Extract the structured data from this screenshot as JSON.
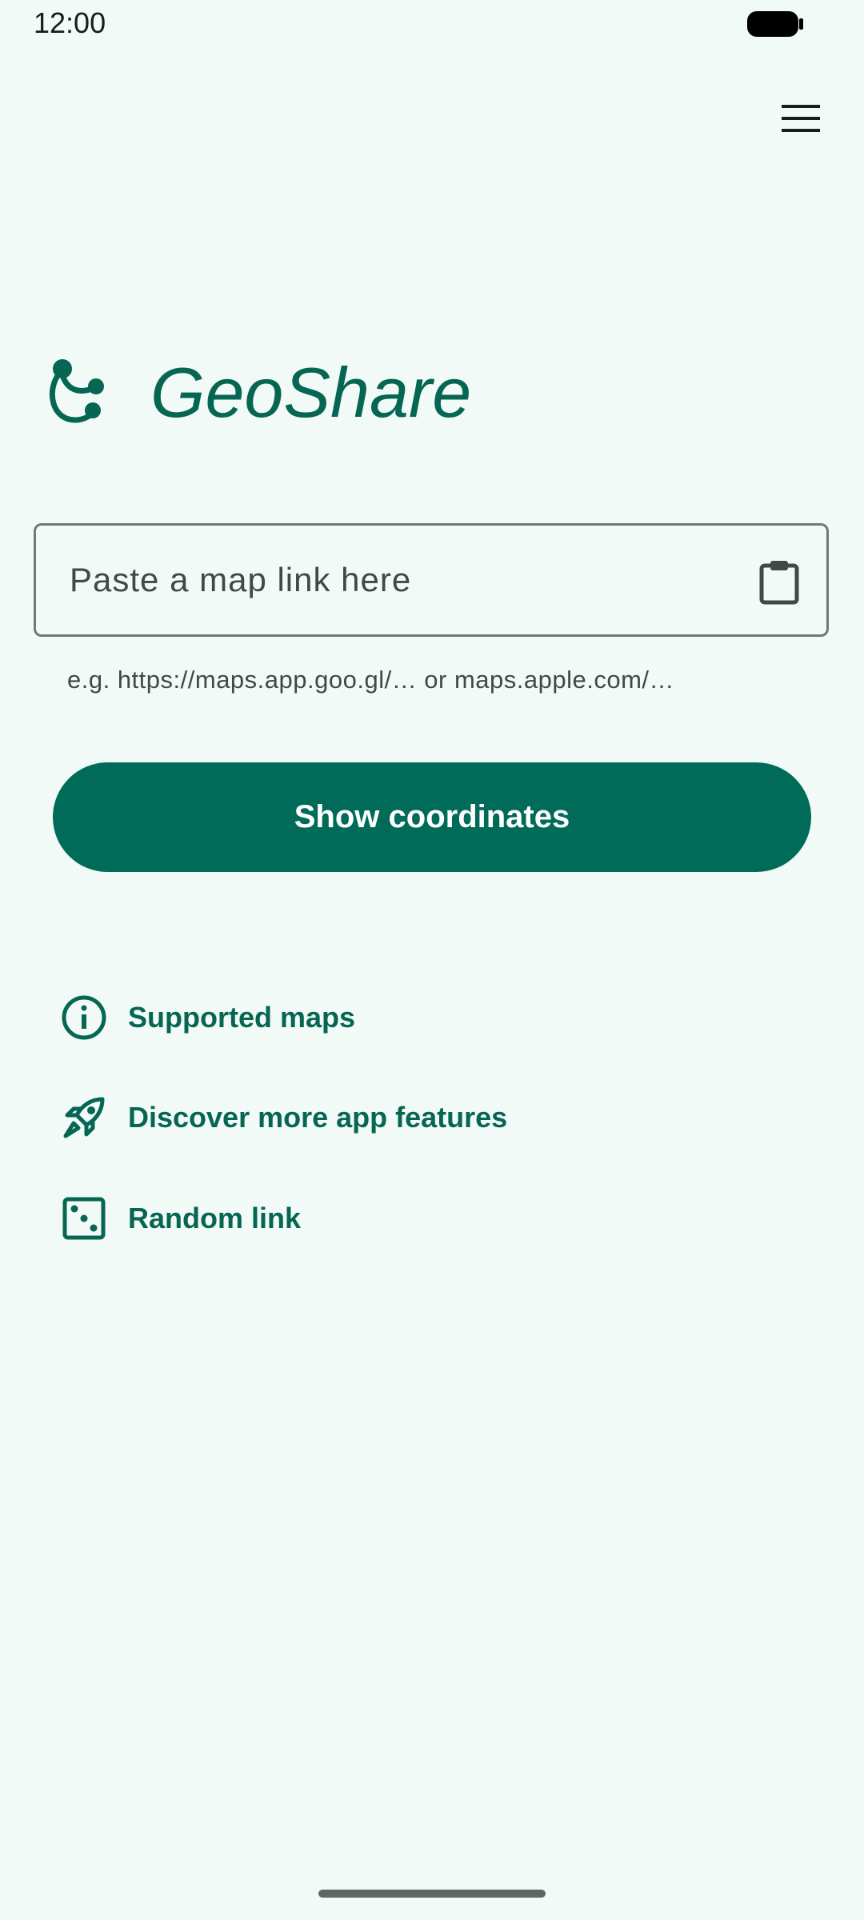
{
  "status_bar": {
    "time": "12:00"
  },
  "header": {
    "app_title": "GeoShare",
    "menu_icon": "hamburger-menu-icon"
  },
  "link_input": {
    "placeholder": "Paste a map link here",
    "value": "",
    "supporting_text": "e.g. https://maps.app.goo.gl/… or maps.apple.com/…",
    "paste_icon": "clipboard-icon"
  },
  "primary_button": {
    "label": "Show coordinates"
  },
  "actions": [
    {
      "label": "Supported maps",
      "icon": "info-icon"
    },
    {
      "label": "Discover more app features",
      "icon": "rocket-icon"
    },
    {
      "label": "Random link",
      "icon": "dice-icon"
    }
  ],
  "colors": {
    "background": "#f1faf6",
    "primary": "#006b58",
    "accent_text": "#066653",
    "on_surface_variant": "#3f4946"
  }
}
